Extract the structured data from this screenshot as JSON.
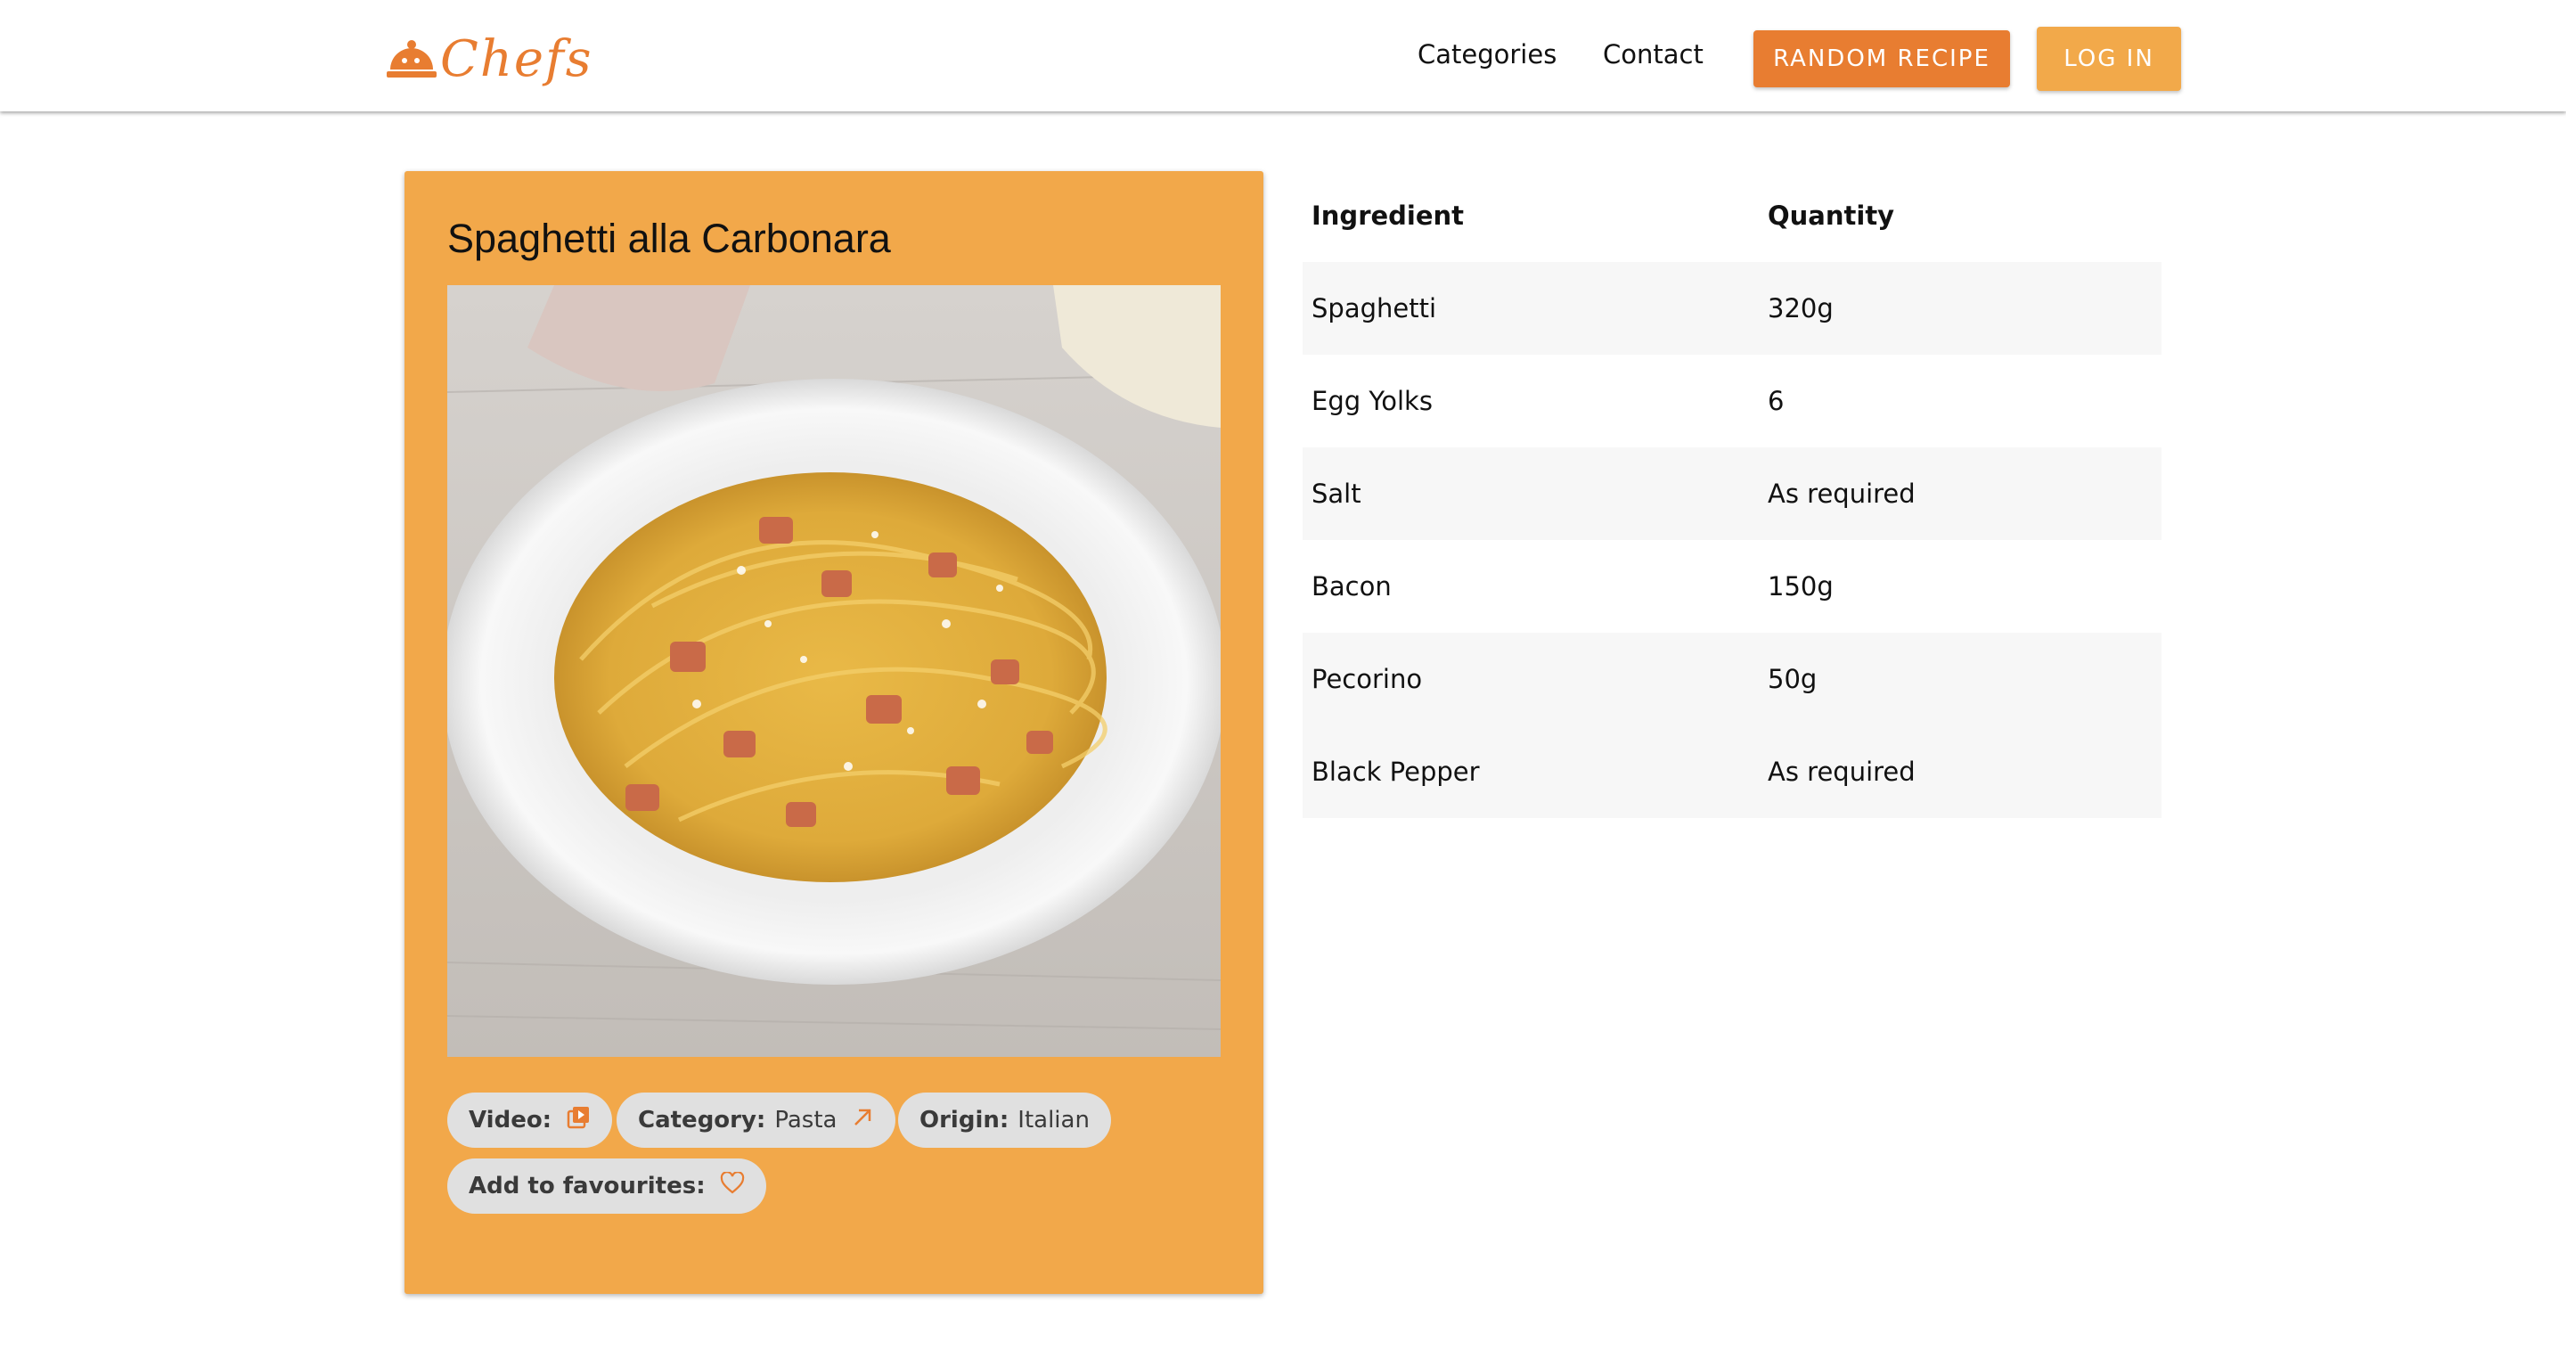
{
  "nav": {
    "logo_text": "Chefs",
    "links": [
      "Categories",
      "Contact"
    ],
    "random_button": "RANDOM RECIPE",
    "login_button": "LOG IN"
  },
  "recipe": {
    "title": "Spaghetti alla Carbonara",
    "chips": {
      "video_label": "Video:",
      "category_label": "Category:",
      "category_value": "Pasta",
      "origin_label": "Origin:",
      "origin_value": "Italian",
      "favourites_label": "Add to favourites:"
    }
  },
  "table": {
    "headers": [
      "Ingredient",
      "Quantity"
    ],
    "rows": [
      {
        "ingredient": "Spaghetti",
        "quantity": "320g"
      },
      {
        "ingredient": "Egg Yolks",
        "quantity": "6"
      },
      {
        "ingredient": "Salt",
        "quantity": "As required"
      },
      {
        "ingredient": "Bacon",
        "quantity": "150g"
      },
      {
        "ingredient": "Pecorino",
        "quantity": "50g"
      },
      {
        "ingredient": "Black Pepper",
        "quantity": "As required"
      }
    ]
  },
  "icons": {
    "logo": "cloche-icon",
    "video": "video-library-icon",
    "category": "arrow-up-right-icon",
    "favourites": "heart-outline-icon"
  },
  "colors": {
    "brand": "#e87d31",
    "card": "#f2a84a",
    "chip": "#e0e0e0"
  }
}
